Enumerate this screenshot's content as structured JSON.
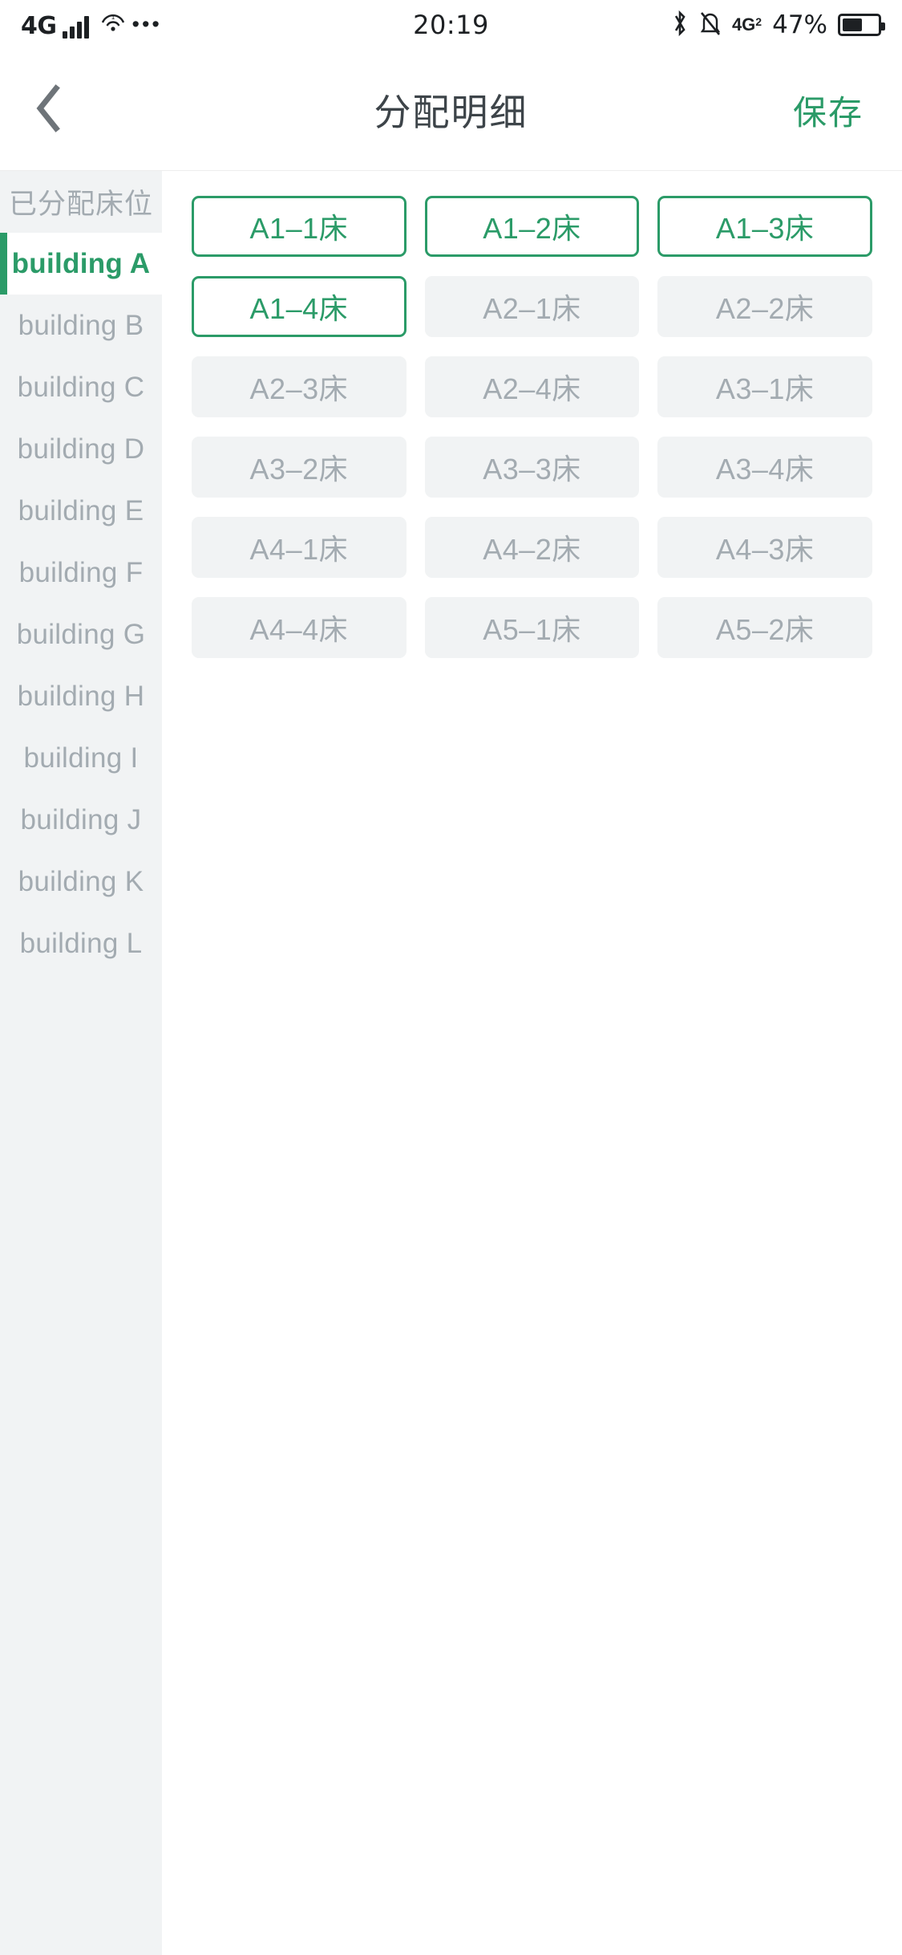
{
  "status_bar": {
    "network_label": "4G",
    "signal_icon": "signal-bars-icon",
    "wifi_icon": "wifi-icon",
    "more_icon": "more-dots-icon",
    "time": "20:19",
    "bluetooth_icon": "bluetooth-icon",
    "mute_icon": "mute-bell-icon",
    "second_sim_label": "4G",
    "second_sim_sub": "2",
    "battery_percent": "47%",
    "battery_icon": "battery-icon"
  },
  "nav": {
    "back_icon": "chevron-left-icon",
    "title": "分配明细",
    "save_label": "保存"
  },
  "sidebar": {
    "items": [
      {
        "label": "已分配床位",
        "active": false,
        "header": true
      },
      {
        "label": "building A",
        "active": true,
        "header": false
      },
      {
        "label": "building B",
        "active": false,
        "header": false
      },
      {
        "label": "building C",
        "active": false,
        "header": false
      },
      {
        "label": "building D",
        "active": false,
        "header": false
      },
      {
        "label": "building E",
        "active": false,
        "header": false
      },
      {
        "label": "building F",
        "active": false,
        "header": false
      },
      {
        "label": "building G",
        "active": false,
        "header": false
      },
      {
        "label": "building H",
        "active": false,
        "header": false
      },
      {
        "label": "building  I",
        "active": false,
        "header": false
      },
      {
        "label": "building J",
        "active": false,
        "header": false
      },
      {
        "label": "building K",
        "active": false,
        "header": false
      },
      {
        "label": "building L",
        "active": false,
        "header": false
      }
    ]
  },
  "beds": {
    "items": [
      {
        "label": "A1–1床",
        "selected": true
      },
      {
        "label": "A1–2床",
        "selected": true
      },
      {
        "label": "A1–3床",
        "selected": true
      },
      {
        "label": "A1–4床",
        "selected": true
      },
      {
        "label": "A2–1床",
        "selected": false
      },
      {
        "label": "A2–2床",
        "selected": false
      },
      {
        "label": "A2–3床",
        "selected": false
      },
      {
        "label": "A2–4床",
        "selected": false
      },
      {
        "label": "A3–1床",
        "selected": false
      },
      {
        "label": "A3–2床",
        "selected": false
      },
      {
        "label": "A3–3床",
        "selected": false
      },
      {
        "label": "A3–4床",
        "selected": false
      },
      {
        "label": "A4–1床",
        "selected": false
      },
      {
        "label": "A4–2床",
        "selected": false
      },
      {
        "label": "A4–3床",
        "selected": false
      },
      {
        "label": "A4–4床",
        "selected": false
      },
      {
        "label": "A5–1床",
        "selected": false
      },
      {
        "label": "A5–2床",
        "selected": false
      }
    ]
  },
  "colors": {
    "accent_green": "#2b9b68",
    "muted_gray": "#a3abb1",
    "panel_gray": "#f1f3f4",
    "title_dark": "#3d4449"
  }
}
